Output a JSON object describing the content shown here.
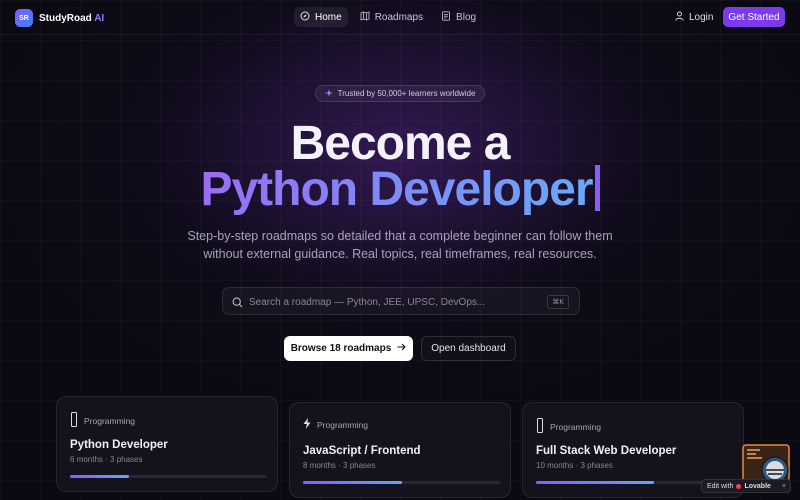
{
  "brand": {
    "badge": "SR",
    "name": "StudyRoad",
    "suffix": " AI"
  },
  "nav": {
    "links": [
      {
        "label": "Home",
        "icon": "compass-icon",
        "active": true
      },
      {
        "label": "Roadmaps",
        "icon": "map-icon",
        "active": false
      },
      {
        "label": "Blog",
        "icon": "document-icon",
        "active": false
      }
    ],
    "login_label": "Login",
    "cta_label": "Get Started"
  },
  "hero": {
    "trusted_label": "Trusted by 50,000+ learners worldwide",
    "line1": "Become a",
    "line2": "Python Developer",
    "subtitle_line1": "Step-by-step roadmaps so detailed that a complete beginner can follow them",
    "subtitle_line2": "without external guidance. Real topics, real timeframes, real resources."
  },
  "search": {
    "placeholder": "Search a roadmap — Python, JEE, UPSC, DevOps...",
    "shortcut": "⌘K"
  },
  "actions": {
    "browse_label": "Browse 18 roadmaps",
    "dashboard_label": "Open dashboard"
  },
  "cards": [
    {
      "category": "Programming",
      "icon": "bar-icon",
      "title": "Python Developer",
      "meta": "6 months · 3 phases",
      "progress": 0.3
    },
    {
      "category": "Programming",
      "icon": "lightning-icon",
      "title": "JavaScript / Frontend",
      "meta": "8 months · 3 phases",
      "progress": 0.5
    },
    {
      "category": "Programming",
      "icon": "bar-icon",
      "title": "Full Stack Web Developer",
      "meta": "10 months · 3 phases",
      "progress": 0.6
    }
  ],
  "edit_badge": {
    "prefix": "Edit with",
    "brand": "Lovable",
    "close": "×"
  },
  "colors": {
    "accent": "#7c3aed",
    "gradient_start": "#9b6cf5",
    "gradient_end": "#6aa8f8"
  }
}
